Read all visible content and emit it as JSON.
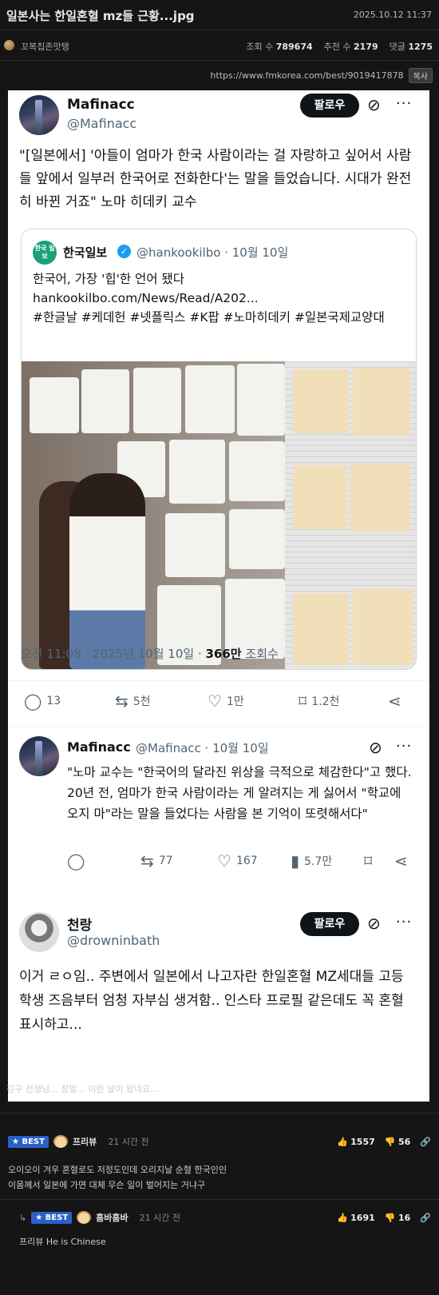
{
  "header": {
    "title": "일본사는 한일혼혈 mz들 근황...jpg",
    "date": "2025.10.12 11:37"
  },
  "meta": {
    "author": "꼬복칩존맛탱",
    "views_label": "조회 수",
    "views": "789674",
    "rec_label": "추천 수",
    "rec": "2179",
    "cmt_label": "댓글",
    "cmt": "1275"
  },
  "url": {
    "text": "https://www.fmkorea.com/best/9019417878",
    "copy": "복사"
  },
  "tweet1": {
    "name": "Mafinacc",
    "handle": "@Mafinacc",
    "follow": "팔로우",
    "more": "···",
    "body": "\"[일본에서] '아들이 엄마가 한국 사람이라는 걸 자랑하고 싶어서 사람들 앞에서 일부러 한국어로 전화한다'는 말을 들었습니다. 시대가 완전히 바뀐 거죠\" 노마 히데키 교수",
    "quote": {
      "avatar": "한국 일보",
      "name": "한국일보",
      "verified": "✓",
      "handle": "@hankookilbo · 10월 10일",
      "line1": "한국어, 가장 '힙'한 언어 됐다",
      "line2": "hankookilbo.com/News/Read/A202...",
      "line3": "#한글날 #케데헌 #넷플릭스 #K팝 #노마히데키 #일본국제교양대"
    },
    "time": "오전 11:08 · 2025년 10월 10일 · ",
    "views": "366만",
    "views_label": " 조회수",
    "actions": {
      "reply": "13",
      "retweet": "5천",
      "like": "1만",
      "bookmark": "1.2천"
    }
  },
  "tweet2": {
    "name": "Mafinacc",
    "handle": "@Mafinacc · 10월 10일",
    "more": "···",
    "body": "\"노마 교수는 \"한국어의 달라진 위상을 극적으로 체감한다\"고 했다. 20년 전, 엄마가 한국 사람이라는 게 알려지는 게 싫어서 \"학교에 오지 마\"라는 말을 들었다는 사람을 본 기억이 또렷해서다\"",
    "actions": {
      "retweet": "77",
      "like": "167",
      "views": "5.7만"
    }
  },
  "tweet3": {
    "name": "천랑",
    "handle": "@drowninbath",
    "follow": "팔로우",
    "more": "···",
    "body": "이거 ㄹㅇ임.. 주변에서 일본에서 나고자란 한일혼혈 MZ세대들 고등학생 즈음부터 엄청 자부심 생겨함.. 인스타 프로필 같은데도 꼭 혼혈 표시하고..."
  },
  "post_comment": "김구 선생님... 정말... 이런 날이 왔네요....",
  "comments": [
    {
      "badge": "★ BEST",
      "name": "프리뷰",
      "ago": "21 시간 전",
      "up": "1557",
      "down": "56",
      "text1": "오이오이 겨우 혼혈로도 저정도인데 오리지날 순혈 한국인인",
      "text2": "이몸께서 일본에 가면 대체 무슨 일이 벌어지는 거냐구"
    },
    {
      "badge": "★ BEST",
      "name": "흠바흠바",
      "ago": "21 시간 전",
      "up": "1691",
      "down": "16",
      "text1": "프리뷰 He is Chinese"
    }
  ],
  "colors": {
    "accent_best": "#2b60c7",
    "verified": "#1d9bf0",
    "bg": "#151515"
  }
}
